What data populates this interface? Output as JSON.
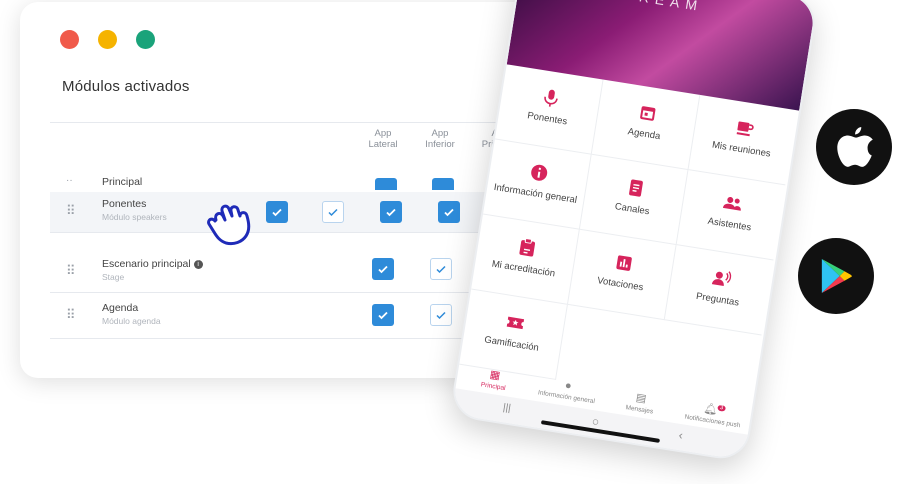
{
  "window": {
    "dots": [
      "#f05a4a",
      "#f5b300",
      "#1aa37a"
    ],
    "title": "Módulos activados"
  },
  "columns": [
    {
      "line1": "App",
      "line2": "Lateral"
    },
    {
      "line1": "App",
      "line2": "Inferior"
    },
    {
      "line1": "App",
      "line2": "Principal"
    }
  ],
  "rows": [
    {
      "name": "Principal",
      "subtitle": ""
    },
    {
      "name": "Ponentes",
      "subtitle": "Módulo speakers"
    },
    {
      "name": "Escenario principal",
      "subtitle": "Stage"
    },
    {
      "name": "Agenda",
      "subtitle": "Módulo agenda"
    }
  ],
  "phone": {
    "banner_text": "LIVESTREAM",
    "tiles": [
      {
        "label": "Ponentes",
        "icon": "microphone-icon"
      },
      {
        "label": "Agenda",
        "icon": "calendar-icon"
      },
      {
        "label": "Mis reuniones",
        "icon": "coffee-icon"
      },
      {
        "label": "Información general",
        "icon": "info-icon"
      },
      {
        "label": "Canales",
        "icon": "document-icon"
      },
      {
        "label": "Asistentes",
        "icon": "people-icon"
      },
      {
        "label": "Mi acreditación",
        "icon": "badge-icon"
      },
      {
        "label": "Votaciones",
        "icon": "poll-icon"
      },
      {
        "label": "Preguntas",
        "icon": "question-icon"
      },
      {
        "label": "Gamificación",
        "icon": "ticket-icon"
      }
    ],
    "bottom_nav": [
      {
        "label": "Principal",
        "icon": "grid-icon"
      },
      {
        "label": "Información general",
        "icon": "info-icon"
      },
      {
        "label": "Mensajes",
        "icon": "chat-icon"
      },
      {
        "label": "Notificaciones push",
        "icon": "bell-icon",
        "badge": "3"
      }
    ],
    "accent": "#d6245c"
  },
  "stores": [
    "apple-icon",
    "google-play-icon"
  ]
}
